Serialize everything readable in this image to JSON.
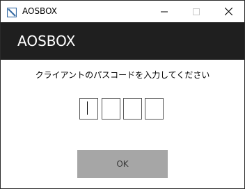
{
  "window": {
    "title": "AOSBOX",
    "icon": "app-logo-icon",
    "controls": [
      "minimize-icon",
      "maximize-icon",
      "close-icon"
    ]
  },
  "header": {
    "title": "AOSBOX"
  },
  "dialog": {
    "prompt": "クライアントのパスコードを入力してください",
    "passcode_digits": [
      "",
      "",
      "",
      ""
    ],
    "ok_label": "OK"
  },
  "colors": {
    "header_bg": "#1f1f1f",
    "header_text": "#ffffff",
    "button_bg": "#a6a6a6",
    "logo_accent": "#3a6ea5"
  }
}
